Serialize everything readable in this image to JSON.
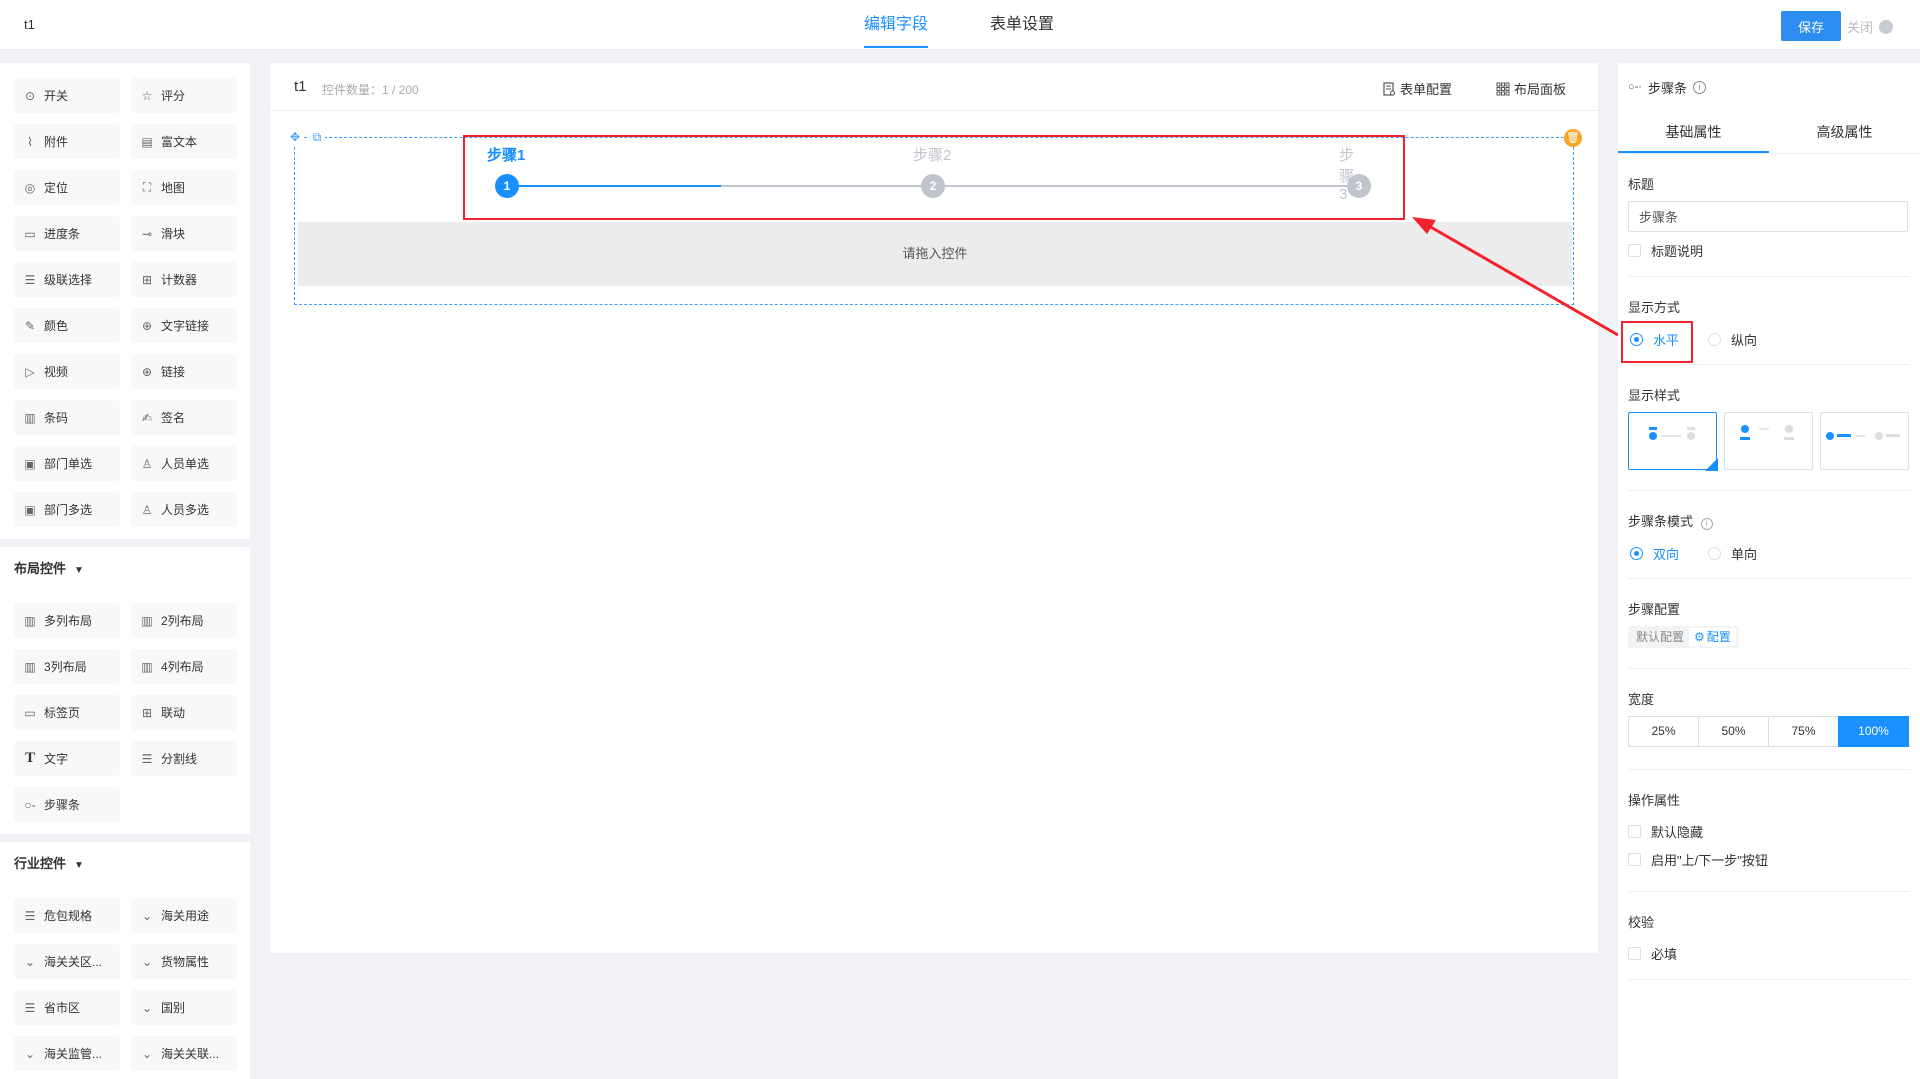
{
  "topbar": {
    "app_title": "t1",
    "tabs": [
      "编辑字段",
      "表单设置"
    ],
    "save_label": "保存",
    "close_label": "关闭"
  },
  "components": {
    "basic": [
      {
        "label": "开关",
        "icon": "toggle-icon"
      },
      {
        "label": "评分",
        "icon": "star-icon"
      },
      {
        "label": "附件",
        "icon": "paperclip-icon"
      },
      {
        "label": "富文本",
        "icon": "rich-text-icon"
      },
      {
        "label": "定位",
        "icon": "location-icon"
      },
      {
        "label": "地图",
        "icon": "map-icon"
      },
      {
        "label": "进度条",
        "icon": "progress-icon"
      },
      {
        "label": "滑块",
        "icon": "slider-icon"
      },
      {
        "label": "级联选择",
        "icon": "cascade-icon"
      },
      {
        "label": "计数器",
        "icon": "counter-icon"
      },
      {
        "label": "颜色",
        "icon": "color-picker-icon"
      },
      {
        "label": "文字链接",
        "icon": "globe-icon"
      },
      {
        "label": "视频",
        "icon": "video-icon"
      },
      {
        "label": "链接",
        "icon": "globe-icon"
      },
      {
        "label": "条码",
        "icon": "barcode-icon"
      },
      {
        "label": "签名",
        "icon": "signature-icon"
      },
      {
        "label": "部门单选",
        "icon": "department-icon"
      },
      {
        "label": "人员单选",
        "icon": "user-icon"
      },
      {
        "label": "部门多选",
        "icon": "department-multi-icon"
      },
      {
        "label": "人员多选",
        "icon": "users-icon"
      }
    ],
    "layout_title": "布局控件",
    "layout": [
      {
        "label": "多列布局",
        "icon": "columns-icon"
      },
      {
        "label": "2列布局",
        "icon": "columns-icon"
      },
      {
        "label": "3列布局",
        "icon": "columns-icon"
      },
      {
        "label": "4列布局",
        "icon": "columns-icon"
      },
      {
        "label": "标签页",
        "icon": "tabs-icon"
      },
      {
        "label": "联动",
        "icon": "linkage-icon"
      },
      {
        "label": "文字",
        "icon": "text-icon"
      },
      {
        "label": "分割线",
        "icon": "divider-icon"
      },
      {
        "label": "步骤条",
        "icon": "steps-icon"
      }
    ],
    "industry_title": "行业控件",
    "industry": [
      {
        "label": "危包规格",
        "icon": "list-icon"
      },
      {
        "label": "海关用途",
        "icon": "chevron-down-icon"
      },
      {
        "label": "海关关区...",
        "icon": "chevron-down-icon"
      },
      {
        "label": "货物属性",
        "icon": "chevron-down-icon"
      },
      {
        "label": "省市区",
        "icon": "list-icon"
      },
      {
        "label": "国别",
        "icon": "chevron-down-icon"
      },
      {
        "label": "海关监管...",
        "icon": "chevron-down-icon"
      },
      {
        "label": "海关关联...",
        "icon": "chevron-down-icon"
      }
    ]
  },
  "canvas": {
    "form_name": "t1",
    "count_label": "控件数量：1 / 200",
    "form_config_label": "表单配置",
    "layout_panel_label": "布局面板",
    "steps": [
      "步骤1",
      "步骤2",
      "步骤3"
    ],
    "step_numbers": [
      "1",
      "2",
      "3"
    ],
    "drop_hint": "请拖入控件"
  },
  "props": {
    "header": "步骤条",
    "tabs": [
      "基础属性",
      "高级属性"
    ],
    "title_label": "标题",
    "title_value": "步骤条",
    "title_desc_label": "标题说明",
    "display_mode_label": "显示方式",
    "display_modes": [
      "水平",
      "纵向"
    ],
    "display_style_label": "显示样式",
    "step_mode_label": "步骤条模式",
    "step_modes": [
      "双向",
      "单向"
    ],
    "step_config_label": "步骤配置",
    "step_config_options": [
      "默认配置",
      "配置"
    ],
    "width_label": "宽度",
    "width_options": [
      "25%",
      "50%",
      "75%",
      "100%"
    ],
    "width_selected": "100%",
    "operation_label": "操作属性",
    "operation_options": [
      "默认隐藏",
      "启用\"上/下一步\"按钮"
    ],
    "validation_label": "校验",
    "validation_options": [
      "必填"
    ]
  },
  "colors": {
    "accent": "#1890ff",
    "highlight": "#f5222d",
    "inactive_step": "#c0c4cc"
  }
}
